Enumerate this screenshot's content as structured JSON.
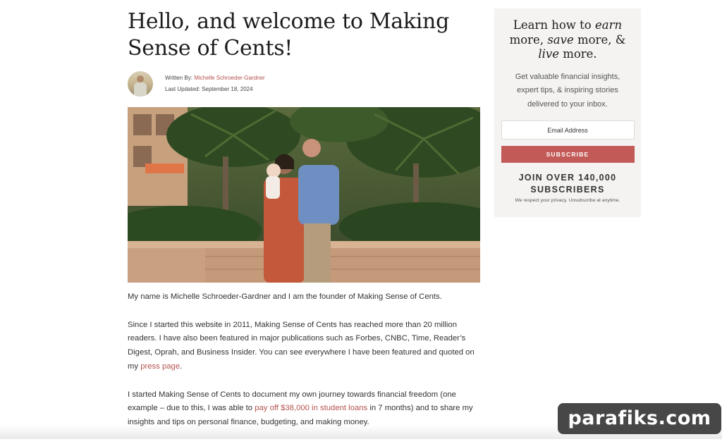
{
  "article": {
    "title": "Hello, and welcome to Making Sense of Cents!",
    "written_by_label": "Written By:",
    "author": "Michelle Schroeder-Gardner",
    "updated_label": "Last Updated:",
    "updated_date": "September 18, 2024",
    "p1": "My name is Michelle Schroeder-Gardner and I am the founder of Making Sense of Cents.",
    "p2_text": "Since I started this website in 2011, Making Sense of Cents has reached more than 20 million readers. I have also been featured in major publications such as Forbes, CNBC, Time, Reader’s Digest, Oprah, and Business Insider. You can see everywhere I have been featured and quoted on my ",
    "p2_link": "press page",
    "p2_end": ".",
    "p3_text": "I started Making Sense of Cents to document my own journey towards financial freedom (one example – due to this, I was able to ",
    "p3_link": "pay off $38,000 in student loans",
    "p3_mid": " in 7 months) and to share my insights and tips on personal finance, budgeting, and making money."
  },
  "sidebar": {
    "headline_1": "Learn how to ",
    "headline_earn": "earn",
    "headline_2": " more, ",
    "headline_save": "save",
    "headline_3": " more, & ",
    "headline_live": "live",
    "headline_4": " more.",
    "description": "Get valuable financial insights, expert tips, & inspiring stories delivered to your inbox.",
    "email_placeholder": "Email Address",
    "subscribe_label": "SUBSCRIBE",
    "join_text": "JOIN OVER 140,000 SUBSCRIBERS",
    "privacy_text": "We respect your privacy. Unsubscribe at anytime."
  },
  "watermark": {
    "text": "parafiks.com"
  },
  "icons": {
    "avatar": "author-photo",
    "hero": "family-photo"
  },
  "colors": {
    "accent": "#c25b58",
    "link": "#b5534f",
    "sidebar_bg": "#f4f3f2"
  }
}
